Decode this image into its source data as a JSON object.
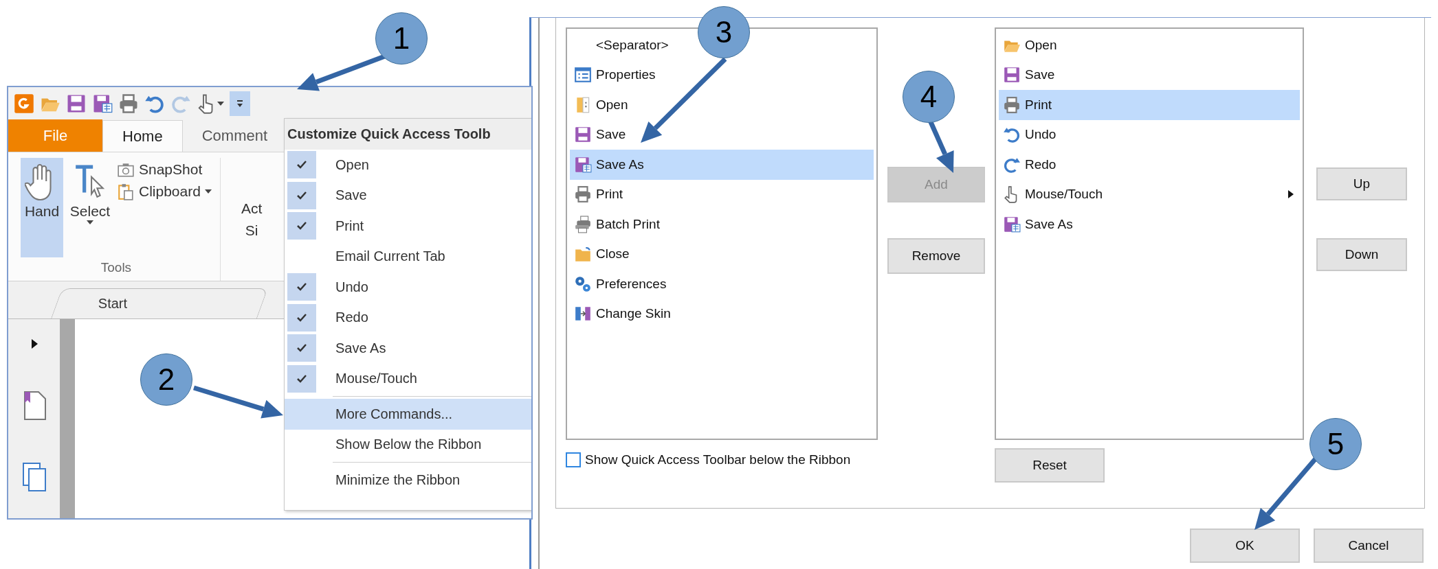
{
  "app_window": {
    "quick_access_toolbar": [
      {
        "kind": "app",
        "disabled": false,
        "selected": false
      },
      {
        "kind": "open",
        "disabled": false,
        "selected": false
      },
      {
        "kind": "save",
        "disabled": false,
        "selected": false
      },
      {
        "kind": "saveas",
        "disabled": false,
        "selected": false
      },
      {
        "kind": "print",
        "disabled": false,
        "selected": false
      },
      {
        "kind": "undo",
        "disabled": false,
        "selected": false
      },
      {
        "kind": "redo",
        "disabled": true,
        "selected": false
      },
      {
        "kind": "touch",
        "disabled": false,
        "selected": false
      },
      {
        "kind": "customize",
        "disabled": false,
        "selected": true
      }
    ],
    "ribbon_tabs": [
      {
        "label": "File",
        "kind": "file",
        "selected": false
      },
      {
        "label": "Home",
        "kind": "tab",
        "selected": true
      },
      {
        "label": "Comment",
        "kind": "tab",
        "selected": false
      }
    ],
    "ribbon": {
      "large_buttons": [
        {
          "label": "Hand",
          "kind": "hand",
          "selected": true,
          "caret": false
        },
        {
          "label": "Select",
          "kind": "select",
          "selected": false,
          "caret": true
        }
      ],
      "small_buttons": [
        {
          "label": "SnapShot",
          "kind": "snapshot",
          "caret": false
        },
        {
          "label": "Clipboard",
          "kind": "clipboard",
          "caret": true
        }
      ],
      "group_label": "Tools",
      "cut_button": [
        "Act",
        "Si"
      ]
    },
    "document_tabs": [
      {
        "label": "Start"
      }
    ],
    "menu": {
      "title": "Customize Quick Access Toolb",
      "items": [
        {
          "kind": "item",
          "label": "Open",
          "checked": true,
          "selected": false
        },
        {
          "kind": "item",
          "label": "Save",
          "checked": true,
          "selected": false
        },
        {
          "kind": "item",
          "label": "Print",
          "checked": true,
          "selected": false
        },
        {
          "kind": "item",
          "label": "Email Current Tab",
          "checked": false,
          "selected": false
        },
        {
          "kind": "item",
          "label": "Undo",
          "checked": true,
          "selected": false
        },
        {
          "kind": "item",
          "label": "Redo",
          "checked": true,
          "selected": false
        },
        {
          "kind": "item",
          "label": "Save As",
          "checked": true,
          "selected": false
        },
        {
          "kind": "item",
          "label": "Mouse/Touch",
          "checked": true,
          "selected": false
        },
        {
          "kind": "separator"
        },
        {
          "kind": "item",
          "label": "More Commands...",
          "checked": false,
          "selected": true
        },
        {
          "kind": "item",
          "label": "Show Below the Ribbon",
          "checked": false,
          "selected": false
        },
        {
          "kind": "separator"
        },
        {
          "kind": "item",
          "label": "Minimize the Ribbon",
          "checked": false,
          "selected": false
        }
      ]
    }
  },
  "dialog": {
    "available_commands": [
      {
        "label": "<Separator>",
        "kind": "none",
        "selected": false
      },
      {
        "label": "Properties",
        "kind": "properties",
        "selected": false
      },
      {
        "label": "Open",
        "kind": "door",
        "selected": false
      },
      {
        "label": "Save",
        "kind": "save",
        "selected": false
      },
      {
        "label": "Save As",
        "kind": "saveas",
        "selected": true
      },
      {
        "label": "Print",
        "kind": "print",
        "selected": false
      },
      {
        "label": "Batch Print",
        "kind": "batchprint",
        "selected": false
      },
      {
        "label": "Close",
        "kind": "close",
        "selected": false
      },
      {
        "label": "Preferences",
        "kind": "preferences",
        "selected": false
      },
      {
        "label": "Change Skin",
        "kind": "skin",
        "selected": false
      }
    ],
    "add_button": {
      "label": "Add",
      "disabled": true
    },
    "remove_button": {
      "label": "Remove",
      "disabled": false
    },
    "toolbar_commands": [
      {
        "label": "Open",
        "kind": "open",
        "selected": false,
        "submenu": false
      },
      {
        "label": "Save",
        "kind": "save",
        "selected": false,
        "submenu": false
      },
      {
        "label": "Print",
        "kind": "print",
        "selected": true,
        "submenu": false
      },
      {
        "label": "Undo",
        "kind": "undo",
        "selected": false,
        "submenu": false
      },
      {
        "label": "Redo",
        "kind": "redo",
        "selected": false,
        "submenu": false
      },
      {
        "label": "Mouse/Touch",
        "kind": "touch",
        "selected": false,
        "submenu": true
      },
      {
        "label": "Save As",
        "kind": "saveas",
        "selected": false,
        "submenu": false
      }
    ],
    "up_button": "Up",
    "down_button": "Down",
    "reset_button": "Reset",
    "below_ribbon_checkbox": {
      "label": "Show Quick Access Toolbar below the Ribbon",
      "checked": false
    },
    "ok_button": "OK",
    "cancel_button": "Cancel"
  },
  "callouts": [
    {
      "label": "1"
    },
    {
      "label": "2"
    },
    {
      "label": "3"
    },
    {
      "label": "4"
    },
    {
      "label": "5"
    }
  ]
}
